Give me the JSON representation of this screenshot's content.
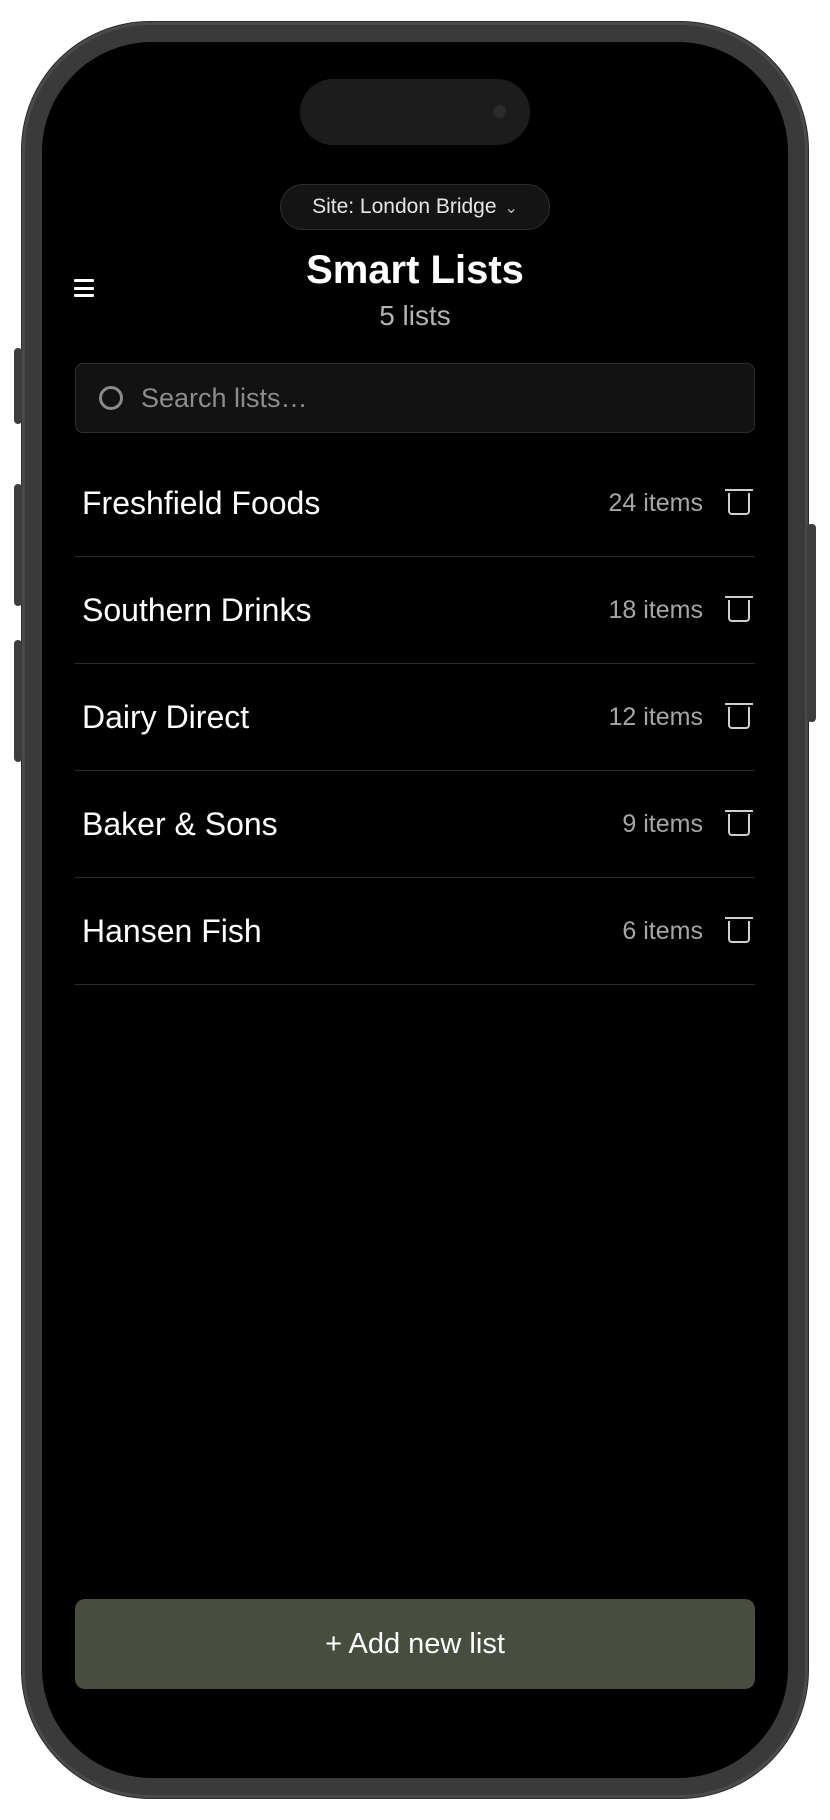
{
  "header": {
    "site_selector": {
      "label": "Site: London Bridge",
      "chevron": "⌄"
    },
    "menu_icon": "hamburger-menu-icon",
    "title": "Smart Lists",
    "subtitle": "5 lists"
  },
  "search": {
    "icon": "search-icon",
    "placeholder": "Search lists…",
    "value": ""
  },
  "lists": [
    {
      "name": "Freshfield Foods",
      "count": "24 items"
    },
    {
      "name": "Southern Drinks",
      "count": "18 items"
    },
    {
      "name": "Dairy Direct",
      "count": "12 items"
    },
    {
      "name": "Baker & Sons",
      "count": "9 items"
    },
    {
      "name": "Hansen Fish",
      "count": "6 items"
    }
  ],
  "footer": {
    "add_button_label": "+ Add new list"
  },
  "colors": {
    "background": "#000000",
    "accent_button": "#474e3f",
    "muted_text": "#a6a6a6"
  }
}
